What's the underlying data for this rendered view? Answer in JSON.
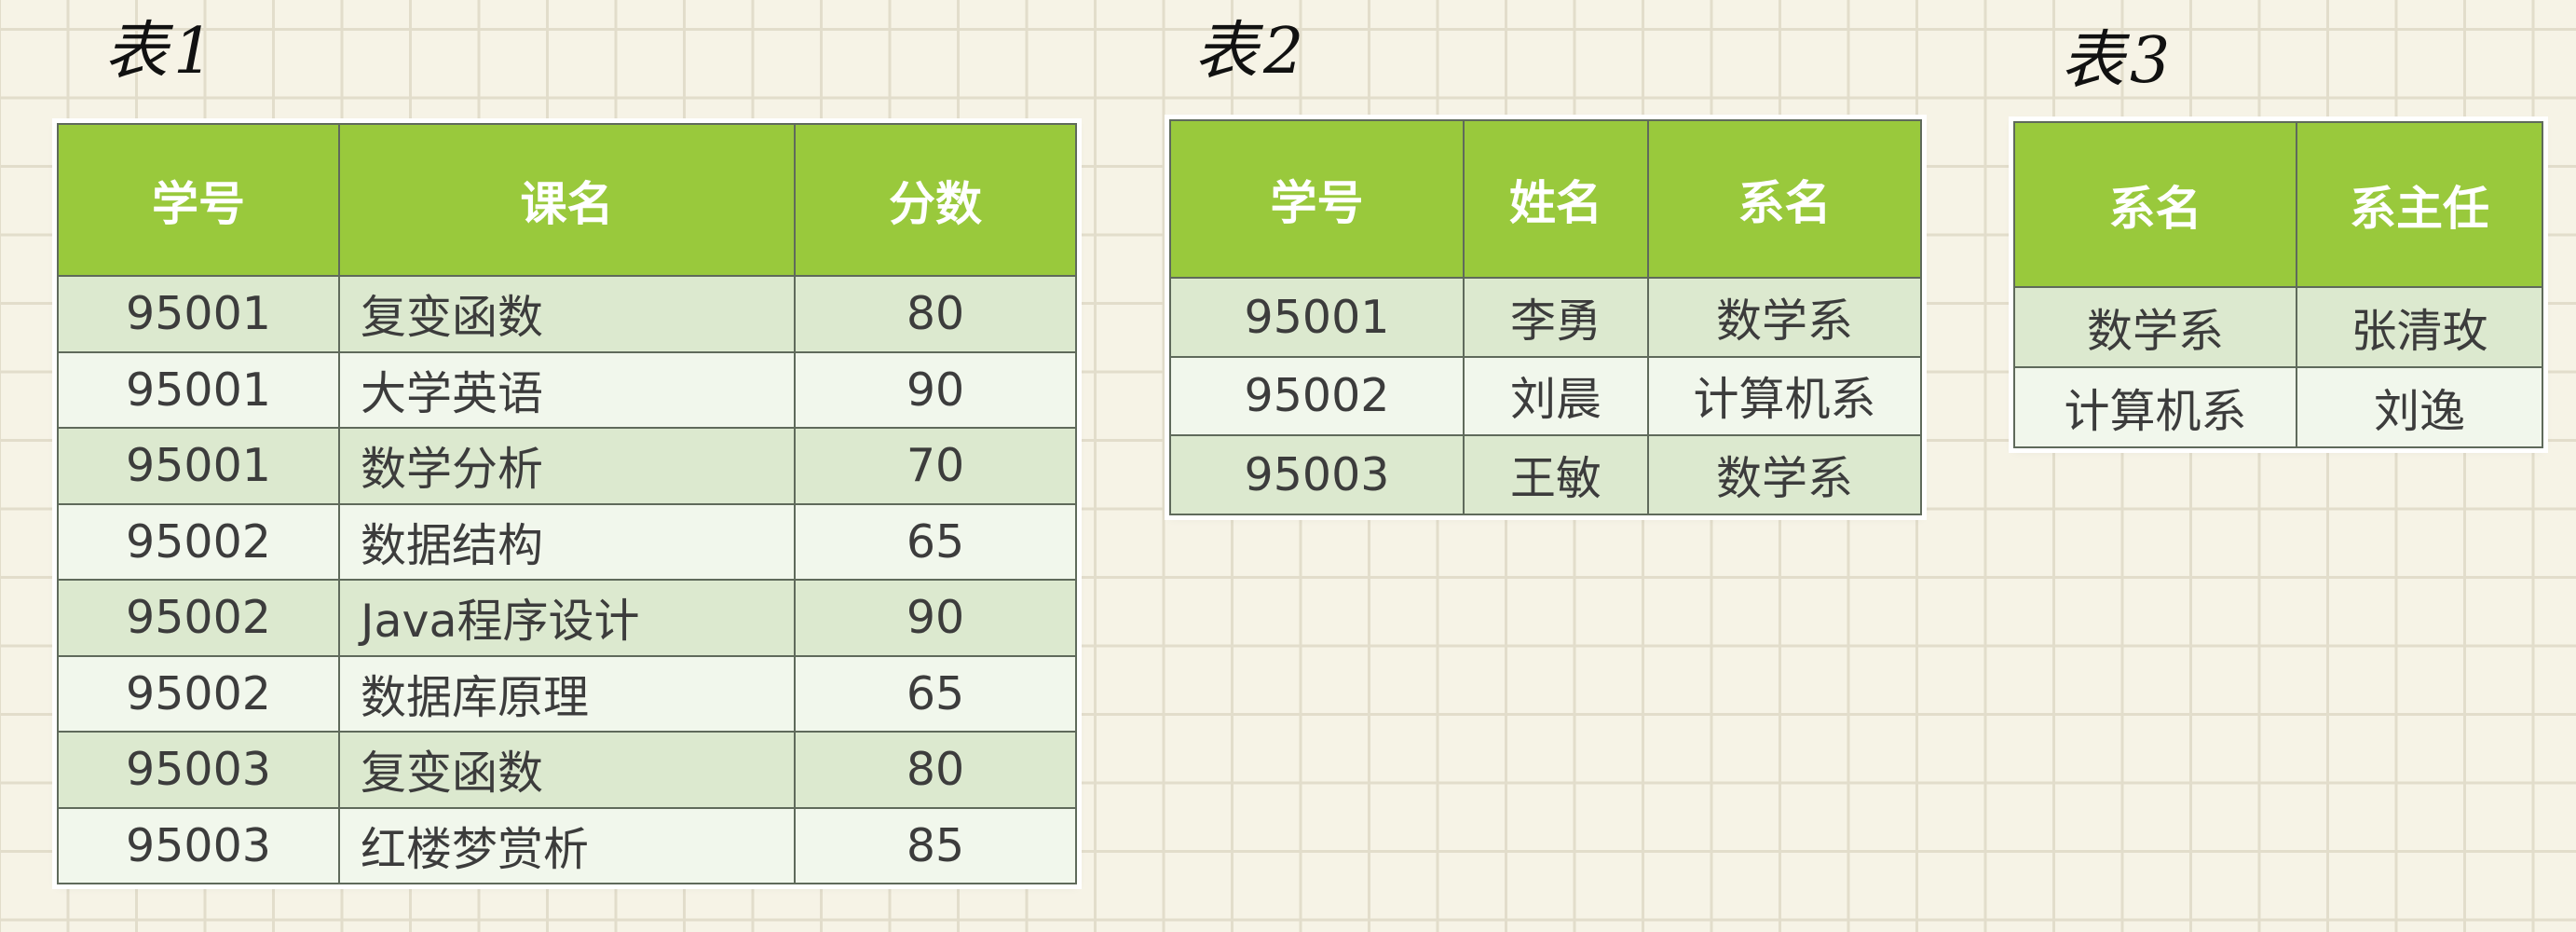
{
  "table1": {
    "caption": "表1",
    "headers": [
      "学号",
      "课名",
      "分数"
    ],
    "rows": [
      [
        "95001",
        "复变函数",
        "80"
      ],
      [
        "95001",
        "大学英语",
        "90"
      ],
      [
        "95001",
        "数学分析",
        "70"
      ],
      [
        "95002",
        "数据结构",
        "65"
      ],
      [
        "95002",
        "Java程序设计",
        "90"
      ],
      [
        "95002",
        "数据库原理",
        "65"
      ],
      [
        "95003",
        "复变函数",
        "80"
      ],
      [
        "95003",
        "红楼梦赏析",
        "85"
      ]
    ]
  },
  "table2": {
    "caption": "表2",
    "headers": [
      "学号",
      "姓名",
      "系名"
    ],
    "rows": [
      [
        "95001",
        "李勇",
        "数学系"
      ],
      [
        "95002",
        "刘晨",
        "计算机系"
      ],
      [
        "95003",
        "王敏",
        "数学系"
      ]
    ]
  },
  "table3": {
    "caption": "表3",
    "headers": [
      "系名",
      "系主任"
    ],
    "rows": [
      [
        "数学系",
        "张清玫"
      ],
      [
        "计算机系",
        "刘逸"
      ]
    ]
  }
}
